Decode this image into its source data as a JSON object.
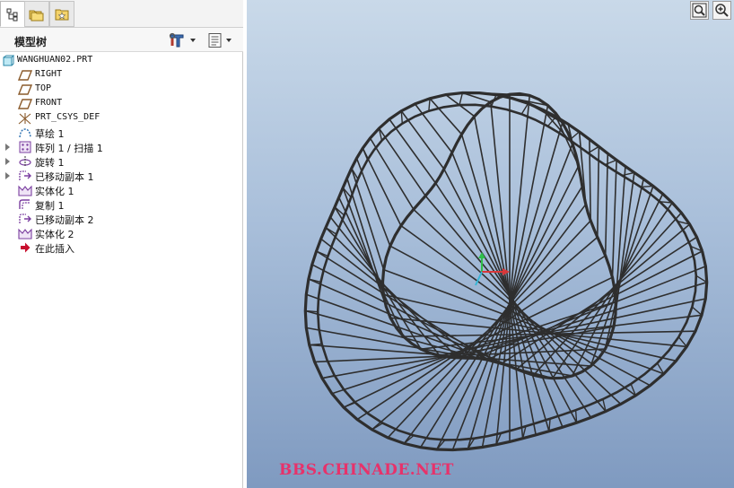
{
  "tabs": [
    {
      "icon": "model-tree-icon"
    },
    {
      "icon": "folder-icon"
    },
    {
      "icon": "favorites-icon"
    }
  ],
  "tree_panel": {
    "title": "模型树"
  },
  "tree": {
    "items": [
      {
        "label": "WANGHUAN02.PRT",
        "icon": "part-icon"
      },
      {
        "label": "RIGHT",
        "icon": "datum-plane-icon"
      },
      {
        "label": "TOP",
        "icon": "datum-plane-icon"
      },
      {
        "label": "FRONT",
        "icon": "datum-plane-icon"
      },
      {
        "label": "PRT_CSYS_DEF",
        "icon": "coordinate-system-icon"
      },
      {
        "label": "草绘 1",
        "icon": "sketch-icon"
      },
      {
        "label": "阵列 1 / 扫描 1",
        "icon": "pattern-icon",
        "expandable": true
      },
      {
        "label": "旋转 1",
        "icon": "revolve-icon",
        "expandable": true
      },
      {
        "label": "已移动副本 1",
        "icon": "moved-copy-icon",
        "expandable": true
      },
      {
        "label": "实体化 1",
        "icon": "solidify-icon"
      },
      {
        "label": "复制 1",
        "icon": "copy-icon"
      },
      {
        "label": "已移动副本 2",
        "icon": "moved-copy-icon"
      },
      {
        "label": "实体化 2",
        "icon": "solidify-icon"
      },
      {
        "label": "在此插入",
        "icon": "insert-here-arrow-icon"
      }
    ]
  },
  "viewport": {
    "watermark": "BBS.CHINADE.NET",
    "toolbar": [
      {
        "icon": "zoom-fit-icon"
      },
      {
        "icon": "zoom-in-icon"
      }
    ]
  },
  "colors": {
    "accent_pink": "#e7326a",
    "plane_icon_brown": "#8a5a2b",
    "feature_purple": "#7b3fa0",
    "wire_gray": "#2e2e2e"
  }
}
